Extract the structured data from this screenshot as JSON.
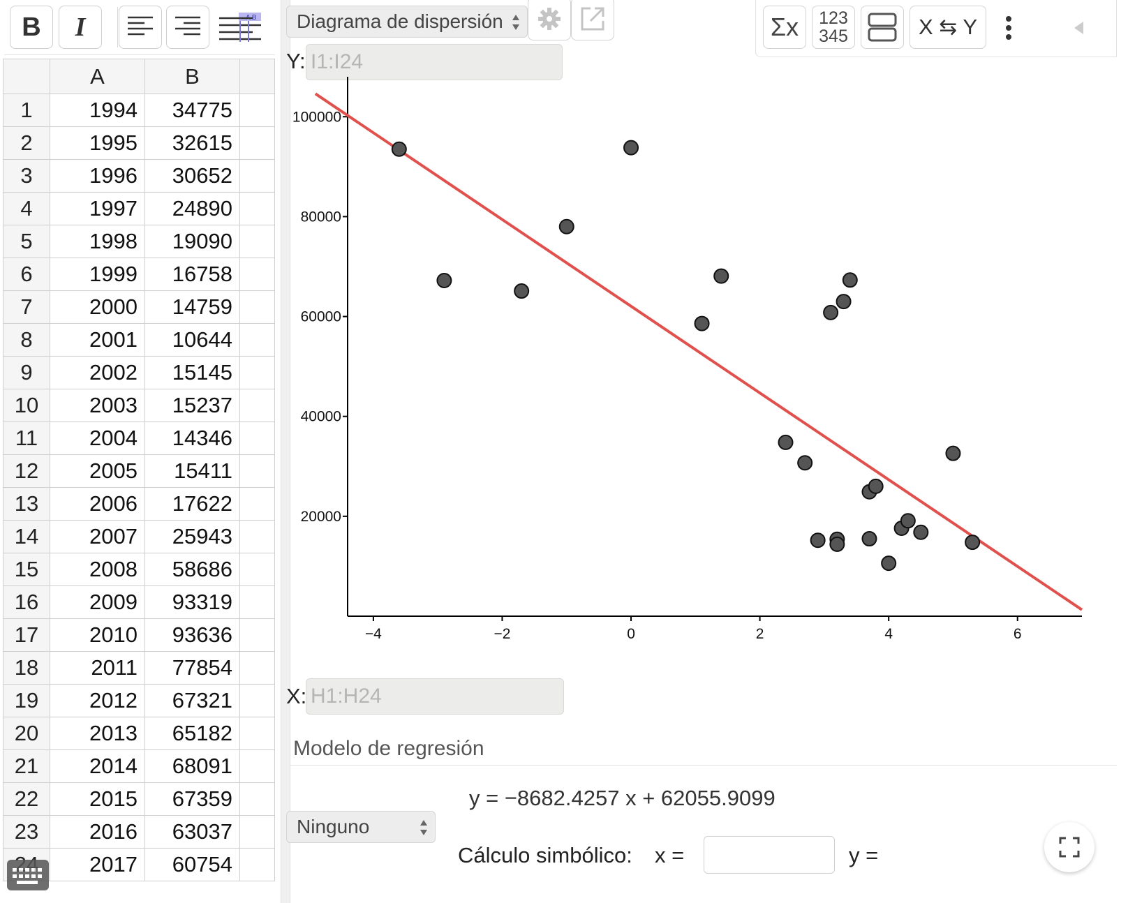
{
  "toolbar": {
    "bold_label": "B",
    "italic_label": "I",
    "icons": [
      "align-left-icon",
      "align-right-icon",
      "cell-borders-icon"
    ]
  },
  "sheet": {
    "columns": [
      "A",
      "B"
    ],
    "rows": [
      {
        "n": "1",
        "a": "1994",
        "b": "34775"
      },
      {
        "n": "2",
        "a": "1995",
        "b": "32615"
      },
      {
        "n": "3",
        "a": "1996",
        "b": "30652"
      },
      {
        "n": "4",
        "a": "1997",
        "b": "24890"
      },
      {
        "n": "5",
        "a": "1998",
        "b": "19090"
      },
      {
        "n": "6",
        "a": "1999",
        "b": "16758"
      },
      {
        "n": "7",
        "a": "2000",
        "b": "14759"
      },
      {
        "n": "8",
        "a": "2001",
        "b": "10644"
      },
      {
        "n": "9",
        "a": "2002",
        "b": "15145"
      },
      {
        "n": "10",
        "a": "2003",
        "b": "15237"
      },
      {
        "n": "11",
        "a": "2004",
        "b": "14346"
      },
      {
        "n": "12",
        "a": "2005",
        "b": "15411"
      },
      {
        "n": "13",
        "a": "2006",
        "b": "17622"
      },
      {
        "n": "14",
        "a": "2007",
        "b": "25943"
      },
      {
        "n": "15",
        "a": "2008",
        "b": "58686"
      },
      {
        "n": "16",
        "a": "2009",
        "b": "93319"
      },
      {
        "n": "17",
        "a": "2010",
        "b": "93636"
      },
      {
        "n": "18",
        "a": "2011",
        "b": "77854"
      },
      {
        "n": "19",
        "a": "2012",
        "b": "67321"
      },
      {
        "n": "20",
        "a": "2013",
        "b": "65182"
      },
      {
        "n": "21",
        "a": "2014",
        "b": "68091"
      },
      {
        "n": "22",
        "a": "2015",
        "b": "67359"
      },
      {
        "n": "23",
        "a": "2016",
        "b": "63037"
      },
      {
        "n": "24",
        "a": "2017",
        "b": "60754"
      }
    ]
  },
  "panel": {
    "plot_type": "Diagrama de dispersión",
    "y_label": "Y:",
    "y_range": "I1:I24",
    "x_label": "X:",
    "x_range": "H1:H24",
    "stats_icon_text": "Σx",
    "data_icon_top": "123",
    "data_icon_bottom": "345",
    "swap_xy_text": "X ⇆ Y",
    "regression_title": "Modelo de regresión",
    "regression_select": "Ninguno",
    "equation": "y = −8682.4257 x + 62055.9099",
    "symbolic_label": "Cálculo simbólico:",
    "sym_x_label": "x =",
    "sym_y_label": "y ="
  },
  "chart_data": {
    "type": "scatter",
    "title": "",
    "xlabel": "",
    "ylabel": "",
    "xlim": [
      -4.4,
      7
    ],
    "ylim": [
      0,
      108000
    ],
    "x_ticks": [
      "−4",
      "−2",
      "0",
      "2",
      "4",
      "6"
    ],
    "y_ticks": [
      "20000",
      "40000",
      "60000",
      "80000",
      "100000"
    ],
    "point_color": "#555555",
    "line_color": "#e0514d",
    "points": [
      {
        "x": -3.6,
        "y": 93500
      },
      {
        "x": -2.9,
        "y": 67200
      },
      {
        "x": -1.7,
        "y": 65100
      },
      {
        "x": -1.0,
        "y": 78000
      },
      {
        "x": 0.0,
        "y": 93800
      },
      {
        "x": 1.1,
        "y": 58600
      },
      {
        "x": 1.4,
        "y": 68100
      },
      {
        "x": 2.4,
        "y": 34800
      },
      {
        "x": 2.7,
        "y": 30700
      },
      {
        "x": 2.9,
        "y": 15200
      },
      {
        "x": 3.1,
        "y": 60800
      },
      {
        "x": 3.2,
        "y": 15400
      },
      {
        "x": 3.2,
        "y": 14400
      },
      {
        "x": 3.3,
        "y": 63000
      },
      {
        "x": 3.4,
        "y": 67300
      },
      {
        "x": 3.7,
        "y": 24900
      },
      {
        "x": 3.7,
        "y": 15500
      },
      {
        "x": 3.8,
        "y": 26000
      },
      {
        "x": 4.0,
        "y": 10600
      },
      {
        "x": 4.2,
        "y": 17600
      },
      {
        "x": 4.3,
        "y": 19100
      },
      {
        "x": 4.5,
        "y": 16800
      },
      {
        "x": 5.0,
        "y": 32600
      },
      {
        "x": 5.3,
        "y": 14800
      }
    ],
    "regression": {
      "slope": -8682.4257,
      "intercept": 62055.9099
    }
  }
}
